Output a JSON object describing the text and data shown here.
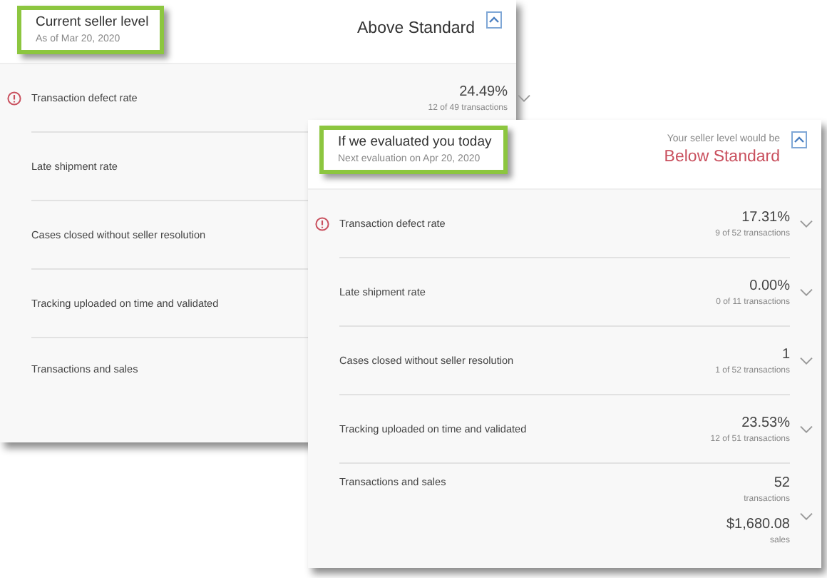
{
  "cards": [
    {
      "title": "Current seller level",
      "subtitle": "As of Mar 20, 2020",
      "highlighted": true,
      "level": "Above Standard",
      "color": "#333333",
      "metrics": [
        {
          "kind": "single",
          "label": "Transaction defect rate",
          "warning": true,
          "value": "24.49%",
          "detail": "12 of 49 transactions"
        },
        {
          "kind": "single",
          "label": "Late shipment rate",
          "warning": false
        },
        {
          "kind": "single",
          "label": "Cases closed without seller resolution",
          "warning": false
        },
        {
          "kind": "single",
          "label": "Tracking uploaded on time and validated",
          "warning": false
        },
        {
          "kind": "dual",
          "label": "Transactions and sales",
          "warning": false
        }
      ]
    },
    {
      "title": "If we evaluated you today",
      "subtitle": "Next evaluation on Apr 20, 2020",
      "highlighted": true,
      "level_caption": "Your seller level would be",
      "level": "Below Standard",
      "color": "#c9505e",
      "metrics": [
        {
          "kind": "single",
          "label": "Transaction defect rate",
          "warning": true,
          "value": "17.31%",
          "detail": "9 of 52 transactions"
        },
        {
          "kind": "single",
          "label": "Late shipment rate",
          "warning": false,
          "value": "0.00%",
          "detail": "0 of 11 transactions"
        },
        {
          "kind": "single",
          "label": "Cases closed without seller resolution",
          "warning": false,
          "value": "1",
          "detail": "1 of 52 transactions"
        },
        {
          "kind": "single",
          "label": "Tracking uploaded on time and validated",
          "warning": false,
          "value": "23.53%",
          "detail": "12 of 51 transactions"
        },
        {
          "kind": "dual",
          "label": "Transactions and sales",
          "warning": false,
          "value": "52",
          "detail": "transactions",
          "value_2": "$1,680.08",
          "detail_2": "sales"
        }
      ]
    }
  ]
}
